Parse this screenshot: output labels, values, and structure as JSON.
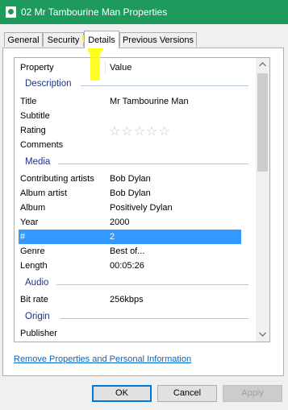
{
  "window": {
    "title": "02 Mr Tambourine Man Properties",
    "titlebar_color": "#1e9a5c"
  },
  "tabs": [
    {
      "label": "General",
      "active": false
    },
    {
      "label": "Security",
      "active": false
    },
    {
      "label": "Details",
      "active": true
    },
    {
      "label": "Previous Versions",
      "active": false
    }
  ],
  "details": {
    "header": {
      "property": "Property",
      "value": "Value"
    },
    "sections": {
      "description": "Description",
      "media": "Media",
      "audio": "Audio",
      "origin": "Origin"
    },
    "description_rows": [
      {
        "key": "Title",
        "value": "Mr Tambourine Man"
      },
      {
        "key": "Subtitle",
        "value": ""
      },
      {
        "key": "Rating",
        "value": "☆☆☆☆☆"
      },
      {
        "key": "Comments",
        "value": ""
      }
    ],
    "media_rows": [
      {
        "key": "Contributing artists",
        "value": "Bob Dylan"
      },
      {
        "key": "Album artist",
        "value": "Bob Dylan"
      },
      {
        "key": "Album",
        "value": "Positively Dylan"
      },
      {
        "key": "Year",
        "value": "2000"
      },
      {
        "key": "#",
        "value": "2",
        "selected": true
      },
      {
        "key": "Genre",
        "value": "Best of..."
      },
      {
        "key": "Length",
        "value": "00:05:26"
      }
    ],
    "audio_rows": [
      {
        "key": "Bit rate",
        "value": "256kbps"
      }
    ],
    "origin_rows": [
      {
        "key": "Publisher",
        "value": ""
      }
    ],
    "selection_color": "#3399ff"
  },
  "link": {
    "label": "Remove Properties and Personal Information"
  },
  "buttons": {
    "ok": "OK",
    "cancel": "Cancel",
    "apply": "Apply"
  },
  "icons": {
    "scroll_up": "chevron-up-icon",
    "scroll_down": "chevron-down-icon",
    "annotation": "yellow-highlight-arrow"
  }
}
